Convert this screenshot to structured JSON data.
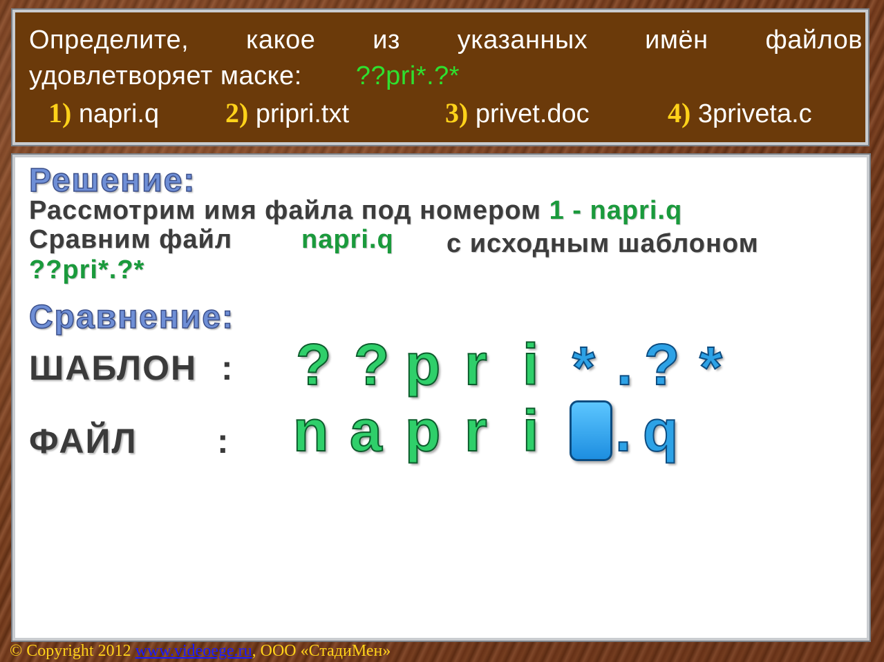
{
  "task": {
    "line1": "Определите, какое из указанных имён файлов",
    "line2": "удовлетворяет маске:",
    "mask": "??pri*.?*",
    "options": [
      {
        "num": "1)",
        "name": "napri.q"
      },
      {
        "num": "2)",
        "name": "pripri.txt"
      },
      {
        "num": "3)",
        "name": "privet.doc"
      },
      {
        "num": "4)",
        "name": "3priveta.c"
      }
    ]
  },
  "solution": {
    "heading": "Решение:",
    "line1_text": "Рассмотрим имя файла под номером",
    "line1_highlight": "1 - napri.q",
    "line2_text": "Сравним файл",
    "line2_highlight": "napri.q",
    "line2_rest": "с исходным шаблоном",
    "line3_highlight": "??pri*.?*"
  },
  "comparison": {
    "heading": "Сравнение:",
    "template_label": "ШАБЛОН",
    "file_label": "ФАЙЛ",
    "colon": ":",
    "template_chars": [
      "?",
      "?",
      "p",
      "r",
      "i",
      "*",
      ".",
      "?",
      "*"
    ],
    "file_chars": [
      "n",
      "a",
      "p",
      "r",
      "i",
      ".",
      "q"
    ]
  },
  "footer": {
    "copyright": "© Copyright 2012",
    "link": "www.videoege.ru",
    "company": ", ООО «СтадиМен»"
  },
  "colors": {
    "task_bg": "#6b3a0a",
    "mask_green": "#2fe02f",
    "option_num": "#ffd21a",
    "heading_blue": "#6f8fd6",
    "highlight_green": "#1a9a3c",
    "char_green": "#2fcf6a",
    "char_blue": "#2da2e6"
  }
}
